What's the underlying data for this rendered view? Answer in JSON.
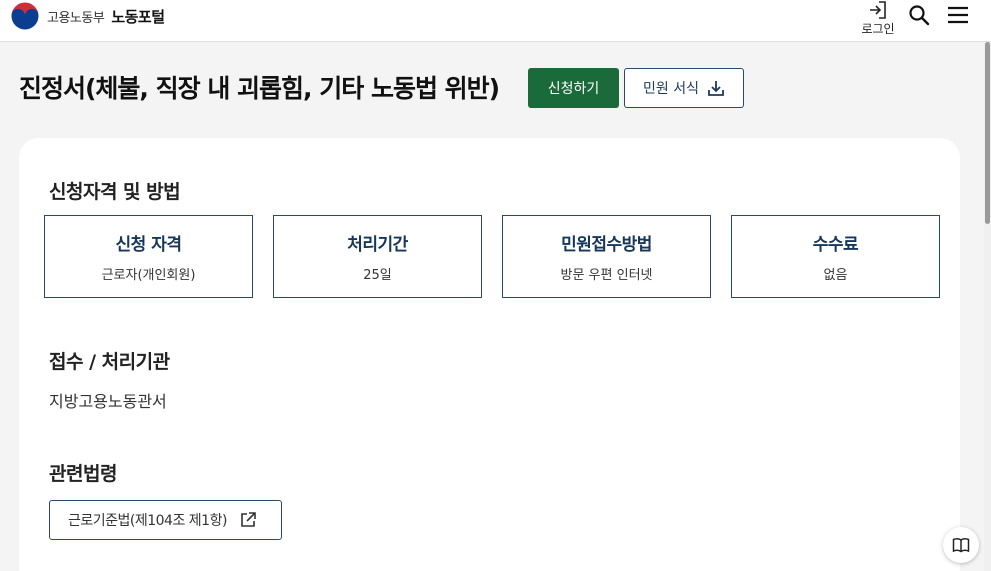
{
  "header": {
    "ministry": "고용노동부",
    "portal": "노동포털",
    "login_label": "로그인",
    "icons": {
      "emblem": "government-emblem-icon",
      "login": "login-icon",
      "search": "search-icon",
      "menu": "hamburger-menu-icon"
    }
  },
  "page": {
    "title": "진정서(체불, 직장 내 괴롭힘, 기타 노동법 위반)",
    "apply_button": "신청하기",
    "form_button": "민원 서식",
    "form_button_icon": "download-icon"
  },
  "sections": {
    "eligibility_heading": "신청자격 및 방법",
    "info_boxes": [
      {
        "title": "신청 자격",
        "value": "근로자(개인회원)"
      },
      {
        "title": "처리기간",
        "value": "25일"
      },
      {
        "title": "민원접수방법",
        "value": "방문 우편 인터넷"
      },
      {
        "title": "수수료",
        "value": "없음"
      }
    ],
    "agency_heading": "접수 / 처리기관",
    "agency_value": "지방고용노동관서",
    "law_heading": "관련법령",
    "law_link": "근로기준법(제104조 제1항)",
    "law_link_icon": "external-link-icon"
  },
  "floating": {
    "icon": "book-icon"
  },
  "colors": {
    "primary_green": "#1b6a3a",
    "navy": "#16375a",
    "background": "#f4f4f5"
  }
}
